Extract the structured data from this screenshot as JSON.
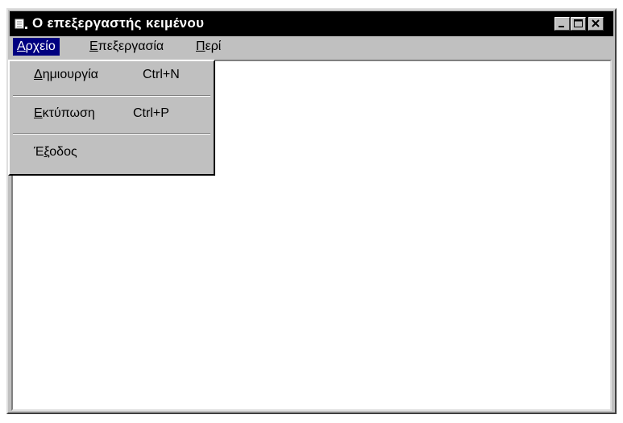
{
  "window": {
    "title": "Ο επεξεργαστής κειμένου",
    "icon": "notepad-icon"
  },
  "title_buttons": {
    "minimize_icon": "minimize-icon",
    "maximize_icon": "maximize-icon",
    "close_icon": "close-icon"
  },
  "menubar": {
    "file": {
      "mnemonic": "Α",
      "rest": "ρχείο"
    },
    "edit": {
      "mnemonic": "Ε",
      "rest": "πεξεργασία"
    },
    "about": {
      "mnemonic": "Π",
      "rest": "ερί"
    }
  },
  "file_menu": {
    "new": {
      "mnemonic": "Δ",
      "rest": "ημιουργία",
      "shortcut": "Ctrl+N"
    },
    "print": {
      "mnemonic": "Ε",
      "rest": "κτύπωση",
      "shortcut": "Ctrl+P"
    },
    "exit": {
      "pre": "Έ",
      "mnemonic": "ξ",
      "rest": "οδος"
    }
  },
  "colors": {
    "titlebar": "#000000",
    "menu_highlight": "#000080",
    "face": "#c0c0c0"
  }
}
